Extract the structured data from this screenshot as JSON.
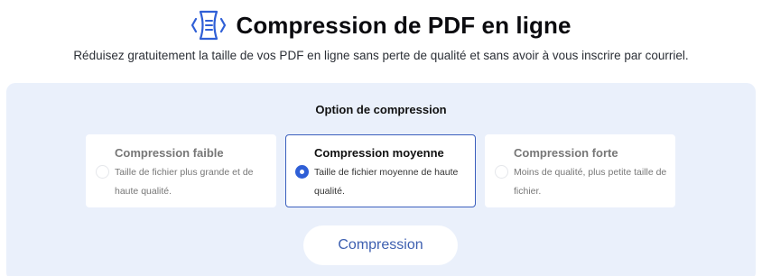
{
  "header": {
    "logo_icon": "compress-document-icon",
    "title": "Compression de PDF en ligne",
    "subtitle": "Réduisez gratuitement la taille de vos PDF en ligne sans perte de qualité et sans avoir à vous inscrire par courriel."
  },
  "compression": {
    "section_title": "Option de compression",
    "options": [
      {
        "title": "Compression faible",
        "description": "Taille de fichier plus grande et de haute qualité.",
        "selected": false
      },
      {
        "title": "Compression moyenne",
        "description": "Taille de fichier moyenne de haute qualité.",
        "selected": true
      },
      {
        "title": "Compression forte",
        "description": "Moins de qualité, plus petite taille de fichier.",
        "selected": false
      }
    ],
    "button_label": "Compression"
  },
  "colors": {
    "accent": "#2f5fd6",
    "panel_background": "#eaf0fb",
    "button_text": "#3d5fb0"
  }
}
